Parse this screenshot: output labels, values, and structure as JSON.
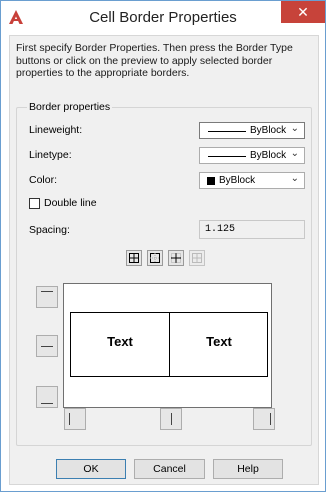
{
  "window": {
    "title": "Cell Border Properties",
    "close_glyph": "✕",
    "icon": "autocad-a-icon",
    "accent": "#c7433a"
  },
  "intro_text": "First specify Border Properties. Then press the Border Type buttons or click on the preview to apply selected border properties to the appropriate borders.",
  "border_properties": {
    "group_label": "Border properties",
    "lineweight": {
      "label": "Lineweight:",
      "value": "ByBlock"
    },
    "linetype": {
      "label": "Linetype:",
      "value": "ByBlock"
    },
    "color": {
      "label": "Color:",
      "value": "ByBlock",
      "swatch": "#000000"
    },
    "double_line": {
      "label": "Double line",
      "checked": false
    },
    "spacing": {
      "label": "Spacing:",
      "value": "1.125"
    }
  },
  "preview": {
    "cells": [
      "Text",
      "Text"
    ]
  },
  "buttons": {
    "ok": "OK",
    "cancel": "Cancel",
    "help": "Help"
  }
}
